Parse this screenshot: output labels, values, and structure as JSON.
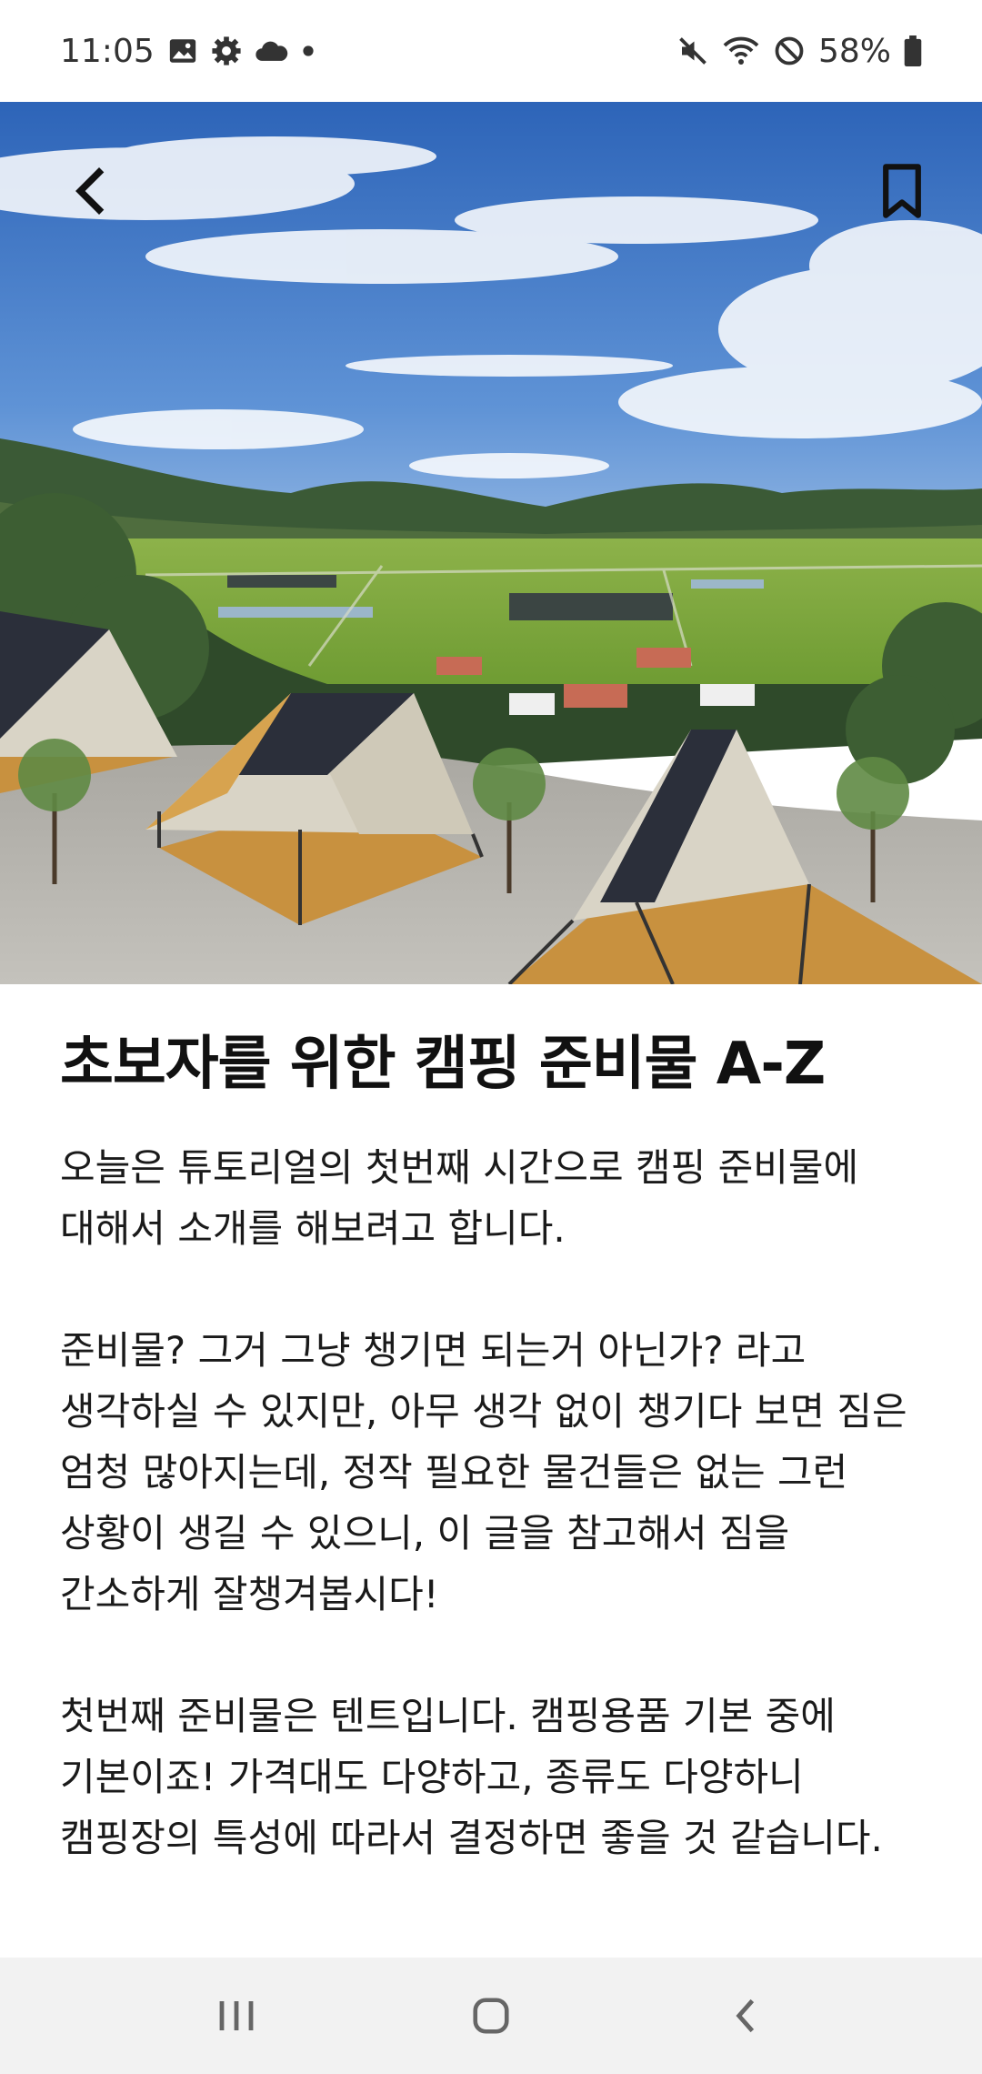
{
  "status_bar": {
    "time": "11:05",
    "battery": "58%",
    "left_icons": [
      "gallery-icon",
      "settings-icon",
      "cloud-icon",
      "dot-icon"
    ],
    "right_icons": [
      "mute-icon",
      "wifi-icon",
      "do-not-disturb-icon",
      "battery-icon"
    ]
  },
  "hero": {
    "back_icon": "back-arrow-icon",
    "bookmark_icon": "bookmark-icon"
  },
  "article": {
    "title": "초보자를 위한 캠핑 준비물 A-Z",
    "paragraphs": [
      "오늘은 튜토리얼의 첫번째 시간으로 캠핑 준비물에 대해서 소개를 해보려고 합니다.",
      "준비물? 그거 그냥 챙기면 되는거 아닌가? 라고 생각하실 수 있지만, 아무 생각 없이 챙기다 보면 짐은 엄청 많아지는데, 정작 필요한 물건들은 없는 그런 상황이 생길 수 있으니, 이 글을 참고해서 짐을 간소하게 잘챙겨봅시다!",
      "첫번째 준비물은 텐트입니다. 캠핑용품 기본 중에 기본이죠! 가격대도 다양하고, 종류도 다양하니 캠핑장의 특성에 따라서 결정하면 좋을 것 같습니다."
    ]
  },
  "nav_bar": {
    "buttons": [
      "recent-apps-icon",
      "home-icon",
      "back-icon"
    ]
  },
  "colors": {
    "sky": "#3f79c8",
    "mountain": "#2f4a2a",
    "field": "#7fae3a",
    "tent_roof": "#2b2f3a",
    "tent_canvas": "#d9d4c6",
    "deck": "#c8913f",
    "gravel": "#b9b7b1",
    "nav_bg": "#f2f2f2"
  }
}
